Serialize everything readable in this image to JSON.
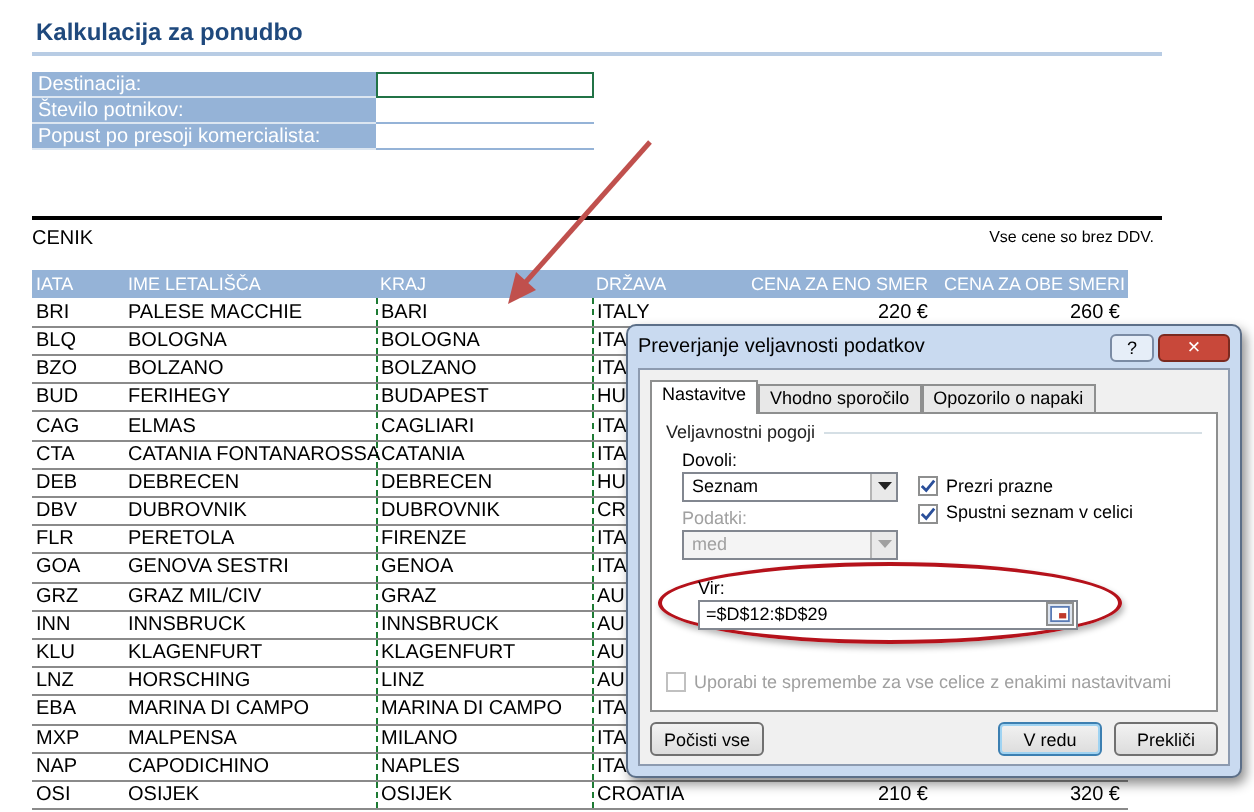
{
  "title": "Kalkulacija za ponudbo",
  "form": [
    {
      "label": "Destinacija:",
      "selected": true
    },
    {
      "label": "Število potnikov:",
      "selected": false
    },
    {
      "label": "Popust po presoji komercialista:",
      "selected": false
    }
  ],
  "price_list": {
    "title": "CENIK",
    "note": "Vse cene so brez DDV.",
    "columns": [
      "IATA",
      "IME LETALIŠČA",
      "KRAJ",
      "DRŽAVA",
      "CENA ZA ENO SMER",
      "CENA ZA OBE SMERI"
    ],
    "rows": [
      [
        "BRI",
        "PALESE MACCHIE",
        "BARI",
        "ITALY",
        "220 €",
        "260 €"
      ],
      [
        "BLQ",
        "BOLOGNA",
        "BOLOGNA",
        "ITA"
      ],
      [
        "BZO",
        "BOLZANO",
        "BOLZANO",
        "ITA"
      ],
      [
        "BUD",
        "FERIHEGY",
        "BUDAPEST",
        "HU"
      ],
      [
        "CAG",
        "ELMAS",
        "CAGLIARI",
        "ITA"
      ],
      [
        "CTA",
        "CATANIA FONTANAROSSA",
        "CATANIA",
        "ITA"
      ],
      [
        "DEB",
        "DEBRECEN",
        "DEBRECEN",
        "HU"
      ],
      [
        "DBV",
        "DUBROVNIK",
        "DUBROVNIK",
        "CR"
      ],
      [
        "FLR",
        "PERETOLA",
        "FIRENZE",
        "ITA"
      ],
      [
        "GOA",
        "GENOVA SESTRI",
        "GENOA",
        "ITA"
      ],
      [
        "GRZ",
        "GRAZ MIL/CIV",
        "GRAZ",
        "AU"
      ],
      [
        "INN",
        "INNSBRUCK",
        "INNSBRUCK",
        "AU"
      ],
      [
        "KLU",
        "KLAGENFURT",
        "KLAGENFURT",
        "AU"
      ],
      [
        "LNZ",
        "HORSCHING",
        "LINZ",
        "AU"
      ],
      [
        "EBA",
        "MARINA DI CAMPO",
        "MARINA DI CAMPO",
        "ITA"
      ],
      [
        "MXP",
        "MALPENSA",
        "MILANO",
        "ITA"
      ],
      [
        "NAP",
        "CAPODICHINO",
        "NAPLES",
        "ITA"
      ],
      [
        "OSI",
        "OSIJEK",
        "OSIJEK",
        "CROATIA",
        "210 €",
        "320 €"
      ]
    ]
  },
  "dialog": {
    "title": "Preverjanje veljavnosti podatkov",
    "help": "?",
    "close": "×",
    "tabs": [
      {
        "label": "Nastavitve",
        "selected": true
      },
      {
        "label": "Vhodno sporočilo",
        "selected": false
      },
      {
        "label": "Opozorilo o napaki",
        "selected": false
      }
    ],
    "group_title": "Veljavnostni pogoji",
    "allow": {
      "label": "Dovoli:",
      "value": "Seznam"
    },
    "options": [
      {
        "label": "Prezri prazne",
        "checked": true
      },
      {
        "label": "Spustni seznam v celici",
        "checked": true
      }
    ],
    "data": {
      "label": "Podatki:",
      "value": "med",
      "disabled": true
    },
    "source": {
      "label": "Vir:",
      "value": "=$D$12:$D$29"
    },
    "apply_all": {
      "label": "Uporabi te spremembe za vse celice z enakimi nastavitvami",
      "checked": false,
      "disabled": true
    },
    "buttons": [
      {
        "label": "Počisti vse",
        "kind": "left"
      },
      {
        "label": "V redu",
        "kind": "default"
      },
      {
        "label": "Prekliči",
        "kind": "plain"
      }
    ]
  }
}
